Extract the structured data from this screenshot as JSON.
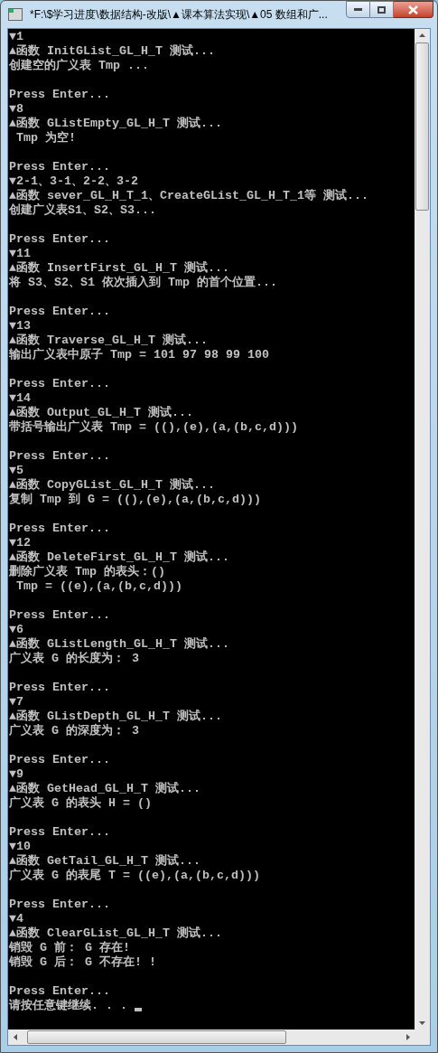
{
  "window": {
    "title": "*F:\\$学习进度\\数据结构-改版\\▲课本算法实现\\▲05 数组和广..."
  },
  "console": {
    "blocks": [
      {
        "lines": [
          "▼1",
          "▲函数 InitGList_GL_H_T 测试...",
          "创建空的广义表 Tmp ..."
        ]
      },
      {
        "lines": [
          "Press Enter...",
          "▼8",
          "▲函数 GListEmpty_GL_H_T 测试...",
          " Tmp 为空!"
        ]
      },
      {
        "lines": [
          "Press Enter...",
          "▼2-1、3-1、2-2、3-2",
          "▲函数 sever_GL_H_T_1、CreateGList_GL_H_T_1等 测试...",
          "创建广义表S1、S2、S3..."
        ]
      },
      {
        "lines": [
          "Press Enter...",
          "▼11",
          "▲函数 InsertFirst_GL_H_T 测试...",
          "将 S3、S2、S1 依次插入到 Tmp 的首个位置..."
        ]
      },
      {
        "lines": [
          "Press Enter...",
          "▼13",
          "▲函数 Traverse_GL_H_T 测试...",
          "输出广义表中原子 Tmp = 101 97 98 99 100"
        ]
      },
      {
        "lines": [
          "Press Enter...",
          "▼14",
          "▲函数 Output_GL_H_T 测试...",
          "带括号输出广义表 Tmp = ((),(e),(a,(b,c,d)))"
        ]
      },
      {
        "lines": [
          "Press Enter...",
          "▼5",
          "▲函数 CopyGList_GL_H_T 测试...",
          "复制 Tmp 到 G = ((),(e),(a,(b,c,d)))"
        ]
      },
      {
        "lines": [
          "Press Enter...",
          "▼12",
          "▲函数 DeleteFirst_GL_H_T 测试...",
          "删除广义表 Tmp 的表头：()",
          " Tmp = ((e),(a,(b,c,d)))"
        ]
      },
      {
        "lines": [
          "Press Enter...",
          "▼6",
          "▲函数 GListLength_GL_H_T 测试...",
          "广义表 G 的长度为： 3"
        ]
      },
      {
        "lines": [
          "Press Enter...",
          "▼7",
          "▲函数 GListDepth_GL_H_T 测试...",
          "广义表 G 的深度为： 3"
        ]
      },
      {
        "lines": [
          "Press Enter...",
          "▼9",
          "▲函数 GetHead_GL_H_T 测试...",
          "广义表 G 的表头 H = ()"
        ]
      },
      {
        "lines": [
          "Press Enter...",
          "▼10",
          "▲函数 GetTail_GL_H_T 测试...",
          "广义表 G 的表尾 T = ((e),(a,(b,c,d)))"
        ]
      },
      {
        "lines": [
          "Press Enter...",
          "▼4",
          "▲函数 ClearGList_GL_H_T 测试...",
          "销毁 G 前： G 存在!",
          "销毁 G 后： G 不存在! !"
        ]
      },
      {
        "lines": [
          "Press Enter...",
          "请按任意键继续. . . "
        ]
      }
    ]
  }
}
